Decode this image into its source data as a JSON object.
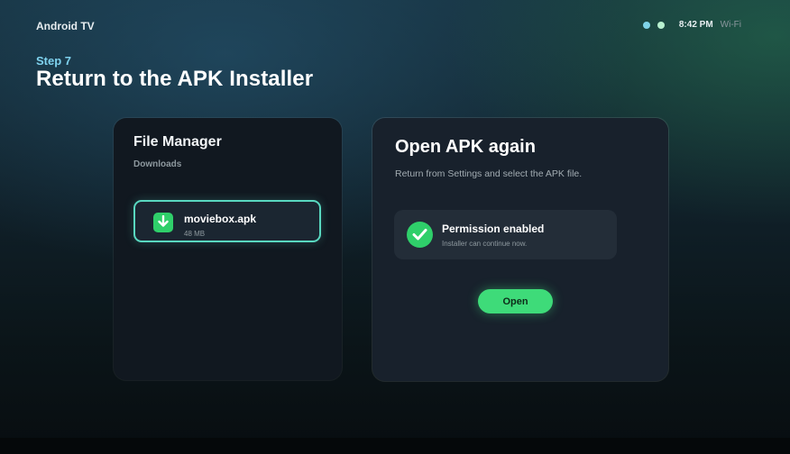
{
  "header": {
    "brand": "Android TV",
    "time": "8:42 PM",
    "network": "Wi-Fi"
  },
  "step": {
    "label": "Step 7",
    "title": "Return to the APK Installer"
  },
  "file_manager": {
    "title": "File Manager",
    "folder": "Downloads",
    "file": {
      "name": "moviebox.apk",
      "size": "48 MB",
      "icon": "download-icon"
    }
  },
  "apk_panel": {
    "title": "Open APK again",
    "description": "Return from Settings and select the APK file.",
    "permission": {
      "title": "Permission enabled",
      "subtitle": "Installer can continue now.",
      "icon": "check-icon"
    },
    "open_label": "Open"
  },
  "colors": {
    "accent_green": "#3edb79",
    "focus_border": "#59d8c0",
    "step_label": "#7fd3ef"
  }
}
